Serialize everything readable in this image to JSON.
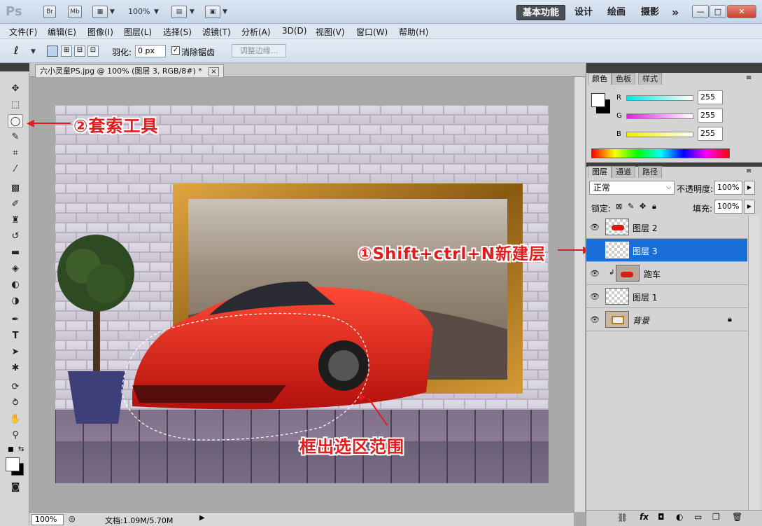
{
  "app": {
    "logo": "Ps",
    "bridge": "Br",
    "minibridge": "Mb",
    "zoom": "100%",
    "workspaces": [
      "基本功能",
      "设计",
      "绘画",
      "摄影"
    ],
    "more": "»"
  },
  "menu": [
    "文件(F)",
    "编辑(E)",
    "图像(I)",
    "图层(L)",
    "选择(S)",
    "滤镜(T)",
    "分析(A)",
    "3D(D)",
    "视图(V)",
    "窗口(W)",
    "帮助(H)"
  ],
  "options": {
    "feather_label": "羽化:",
    "feather_value": "0 px",
    "antialias_label": "消除锯齿",
    "refine_edge": "调整边缘..."
  },
  "document": {
    "tab_title": "六小灵童PS.jpg @ 100% (图层 3, RGB/8#) *",
    "close": "×"
  },
  "status": {
    "zoom": "100%",
    "doc_info": "文档:1.09M/5.70M"
  },
  "annotations": {
    "lasso": "②套索工具",
    "new_layer": "①Shift+ctrl+N新建层",
    "selection": "框出选区范围"
  },
  "color_panel": {
    "tabs": [
      "颜色",
      "色板",
      "样式"
    ],
    "channels": [
      {
        "label": "R",
        "value": "255",
        "color": "#00c8d8"
      },
      {
        "label": "G",
        "value": "255",
        "color": "#e040d8"
      },
      {
        "label": "B",
        "value": "255",
        "color": "#e8e820"
      }
    ]
  },
  "layers_panel": {
    "tabs": [
      "图层",
      "通道",
      "路径"
    ],
    "blend_mode": "正常",
    "opacity_label": "不透明度:",
    "opacity_value": "100%",
    "lock_label": "锁定:",
    "fill_label": "填充:",
    "fill_value": "100%",
    "layers": [
      {
        "name": "图层 2",
        "selected": false
      },
      {
        "name": "图层 3",
        "selected": true
      },
      {
        "name": "跑车",
        "selected": false
      },
      {
        "name": "图层 1",
        "selected": false
      },
      {
        "name": "背景",
        "selected": false
      }
    ],
    "footer_icons": [
      "link-icon",
      "fx-icon",
      "mask-icon",
      "adjustment-icon",
      "group-icon",
      "new-layer-icon",
      "trash-icon"
    ]
  }
}
